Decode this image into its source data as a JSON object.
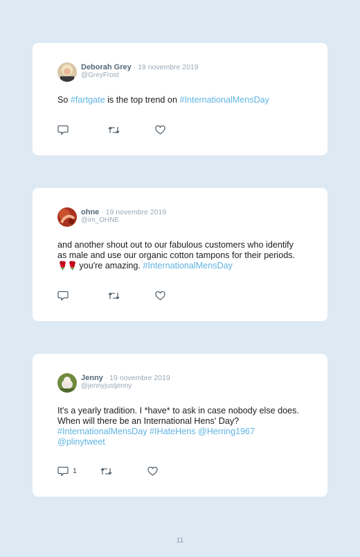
{
  "tweets": [
    {
      "name": "Deborah Grey",
      "date": " · 19 novembre 2019",
      "handle": "@GreyFrost",
      "text_parts": [
        {
          "t": "So ",
          "link": false
        },
        {
          "t": "#fartgate",
          "link": true
        },
        {
          "t": " is the top trend on ",
          "link": false
        },
        {
          "t": "#InternationalMensDay",
          "link": true
        }
      ],
      "reply_count": ""
    },
    {
      "name": "ohne",
      "date": " · 19 novembre 2019",
      "handle": "@im_OHNE",
      "text_parts": [
        {
          "t": "and another shout out to our fabulous customers who identify as male and use our organic cotton tampons for their periods. ",
          "link": false
        },
        {
          "t": "🌹🌹",
          "link": false,
          "emoji": true
        },
        {
          "t": " you're amazing. ",
          "link": false
        },
        {
          "t": "#InternationalMensDay",
          "link": true
        }
      ],
      "reply_count": ""
    },
    {
      "name": "Jenny",
      "date": " · 19 novembre 2019",
      "handle": "@jennyjustjenny",
      "text_parts": [
        {
          "t": "It's a yearly tradition. I *have* to ask in case nobody else does. When will there be an International Hens' Day? ",
          "link": false
        },
        {
          "t": "#InternationalMensDay",
          "link": true
        },
        {
          "t": " ",
          "link": false
        },
        {
          "t": "#IHateHens",
          "link": true
        },
        {
          "t": " ",
          "link": false
        },
        {
          "t": "@Herring1967",
          "link": true
        },
        {
          "t": " ",
          "link": false
        },
        {
          "t": "@plinytweet",
          "link": true
        }
      ],
      "reply_count": "1"
    }
  ],
  "page_number": "11",
  "colors": {
    "background": "#dde9f3",
    "card": "#ffffff",
    "link": "#5fb4e2",
    "name": "#556877",
    "muted": "#9aa8b4"
  },
  "icons": [
    "reply-icon",
    "retweet-icon",
    "like-icon"
  ]
}
